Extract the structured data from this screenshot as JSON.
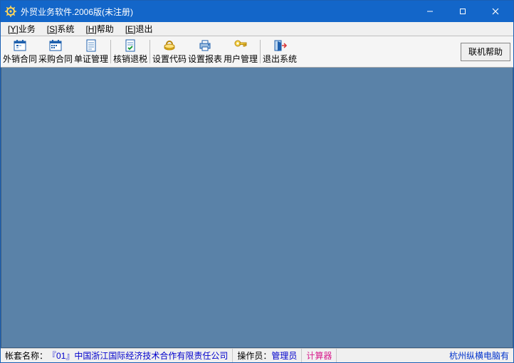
{
  "window": {
    "title": "外贸业务软件.2006版(未注册)"
  },
  "menu": {
    "items": [
      {
        "hotkey": "Y",
        "label": "业务"
      },
      {
        "hotkey": "S",
        "label": "系统"
      },
      {
        "hotkey": "H",
        "label": "帮助"
      },
      {
        "hotkey": "E",
        "label": "退出"
      }
    ]
  },
  "toolbar": {
    "buttons": [
      {
        "label": "外销合同"
      },
      {
        "label": "采购合同"
      },
      {
        "label": "单证管理"
      },
      {
        "label": "核销退税"
      },
      {
        "label": "设置代码"
      },
      {
        "label": "设置报表"
      },
      {
        "label": "用户管理"
      },
      {
        "label": "退出系统"
      }
    ],
    "help_button": "联机帮助"
  },
  "status": {
    "account_label": "帐套名称：",
    "account_value": "『01』中国浙江国际经济技术合作有限责任公司",
    "operator_label": "操作员：",
    "operator_value": "管理员",
    "calculator": "计算器",
    "brand": "杭州纵横电脑有"
  }
}
